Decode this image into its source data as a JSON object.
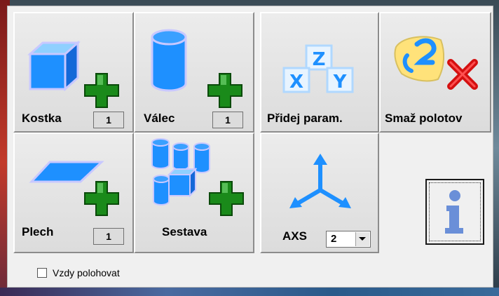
{
  "tiles": {
    "kostka": {
      "label": "Kostka",
      "count": "1"
    },
    "valec": {
      "label": "Válec",
      "count": "1"
    },
    "pridej": {
      "label": "Přidej param."
    },
    "smaz": {
      "label": "Smaž polotov"
    },
    "plech": {
      "label": "Plech",
      "count": "1"
    },
    "sestava": {
      "label": "Sestava"
    },
    "axs": {
      "label": "AXS",
      "value": "2"
    }
  },
  "param_icon_letters": {
    "x": "X",
    "y": "Y",
    "z": "Z"
  },
  "checkbox": {
    "label": "Vzdy polohovat",
    "checked": false
  },
  "colors": {
    "shape_blue": "#1e90ff",
    "plus_green": "#1a8a1a",
    "delete_red": "#d41010",
    "info_blue": "#6a8fd8"
  },
  "icons": {
    "kostka": "cube-icon",
    "valec": "cylinder-icon",
    "pridej": "xyz-blocks-icon",
    "smaz": "erase-icon",
    "plech": "sheet-icon",
    "sestava": "assembly-icon",
    "axs": "axes-icon",
    "info": "info-icon"
  }
}
